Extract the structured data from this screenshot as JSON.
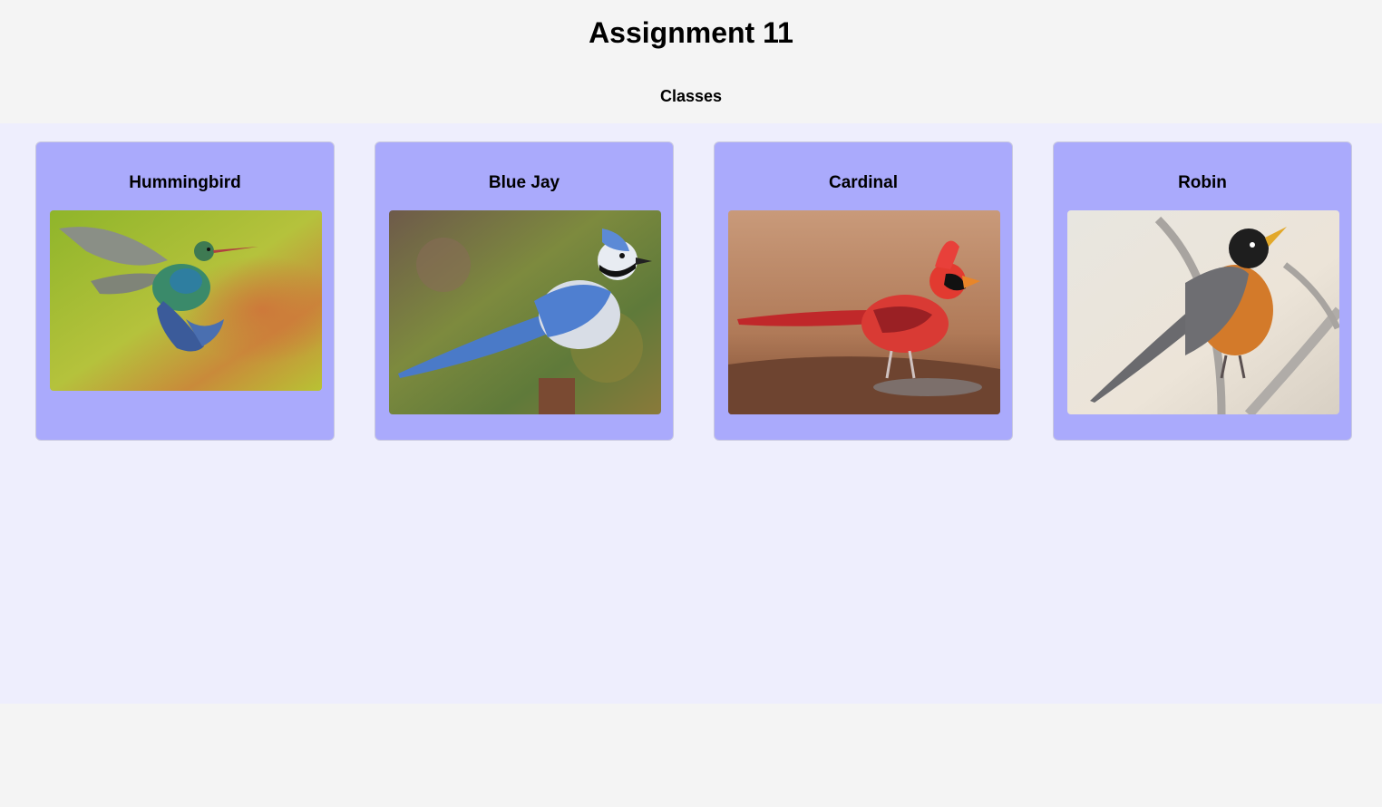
{
  "page": {
    "title": "Assignment 11",
    "section_heading": "Classes"
  },
  "cards": [
    {
      "title": "Hummingbird",
      "image": "hummingbird-photo"
    },
    {
      "title": "Blue Jay",
      "image": "blue-jay-photo"
    },
    {
      "title": "Cardinal",
      "image": "cardinal-photo"
    },
    {
      "title": "Robin",
      "image": "robin-photo"
    }
  ],
  "colors": {
    "page_background": "#f4f4f4",
    "content_background": "#eeeefd",
    "card_background": "#aaaafc"
  }
}
